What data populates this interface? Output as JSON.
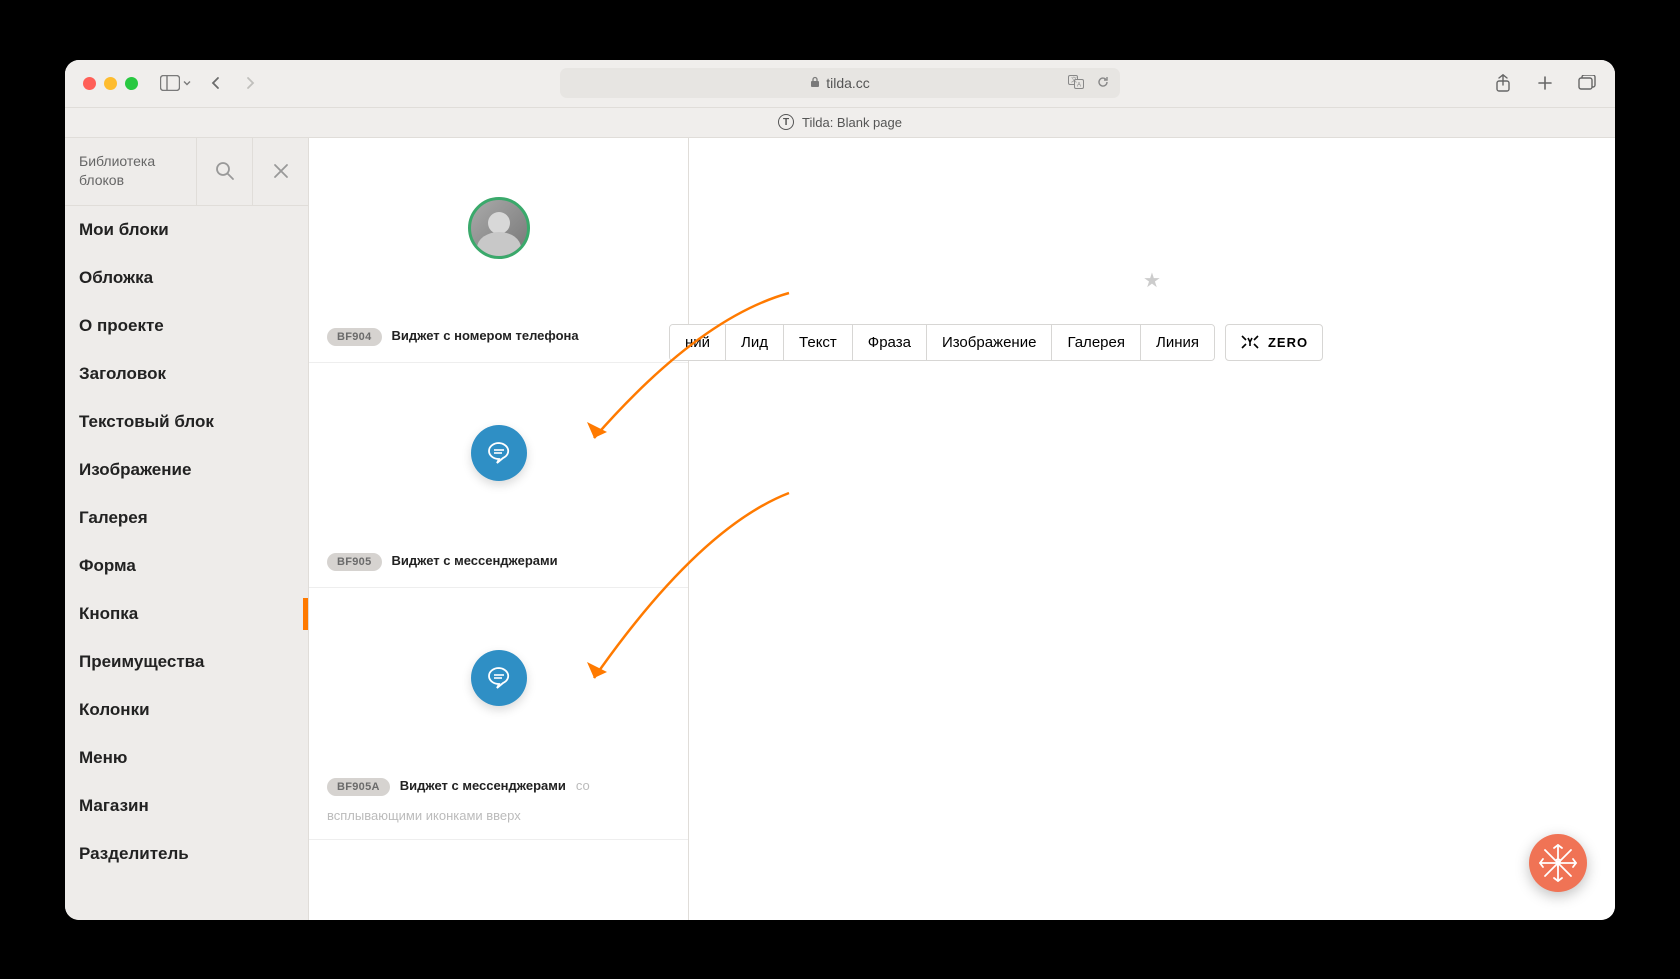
{
  "browser": {
    "url_domain": "tilda.cc",
    "tab_title": "Tilda: Blank page"
  },
  "sidebar": {
    "title": "Библиотека блоков",
    "items": [
      {
        "label": "Мои блоки"
      },
      {
        "label": "Обложка"
      },
      {
        "label": "О проекте"
      },
      {
        "label": "Заголовок"
      },
      {
        "label": "Текстовый блок"
      },
      {
        "label": "Изображение"
      },
      {
        "label": "Галерея"
      },
      {
        "label": "Форма"
      },
      {
        "label": "Кнопка",
        "active": true
      },
      {
        "label": "Преимущества"
      },
      {
        "label": "Колонки"
      },
      {
        "label": "Меню"
      },
      {
        "label": "Магазин"
      },
      {
        "label": "Разделитель"
      }
    ]
  },
  "blocks": [
    {
      "code": "BF904",
      "title": "Виджет с номером телефона",
      "preview": "avatar"
    },
    {
      "code": "BF905",
      "title": "Виджет с мессенджерами",
      "preview": "chat"
    },
    {
      "code": "BF905A",
      "title": "Виджет с мессенджерами",
      "subtitle": "со всплывающими иконками вверх",
      "preview": "chat"
    }
  ],
  "toolbar": {
    "buttons": [
      "ний",
      "Лид",
      "Текст",
      "Фраза",
      "Изображение",
      "Галерея",
      "Линия"
    ],
    "zero_label": "ZERO"
  },
  "colors": {
    "accent": "#ff7a00",
    "chat_bubble": "#2f8fc5",
    "help_fab": "#f07355",
    "avatar_ring": "#3aa96b"
  }
}
